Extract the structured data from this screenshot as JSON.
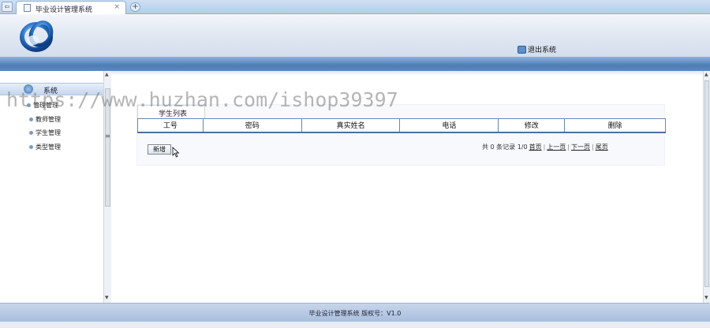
{
  "browser": {
    "tab_title": "毕业设计管理系统",
    "tab_close": "×",
    "new_tab": "+",
    "nav_glyph": "⇦"
  },
  "header": {
    "logout_label": "退出系统"
  },
  "sidebar": {
    "section_label": "系统",
    "items": [
      {
        "label": "管理管理"
      },
      {
        "label": "教师管理"
      },
      {
        "label": "学生管理"
      },
      {
        "label": "类型管理"
      }
    ],
    "grip": "≡"
  },
  "main": {
    "panel_title": "学生列表",
    "columns": [
      "工号",
      "密码",
      "真实姓名",
      "电话",
      "修改",
      "删除"
    ],
    "add_button": "新增",
    "pager": {
      "summary": "共 0 条记录 1/0",
      "first": "首页",
      "prev": "上一页",
      "next": "下一页",
      "last": "尾页",
      "sep": "|"
    }
  },
  "watermark": "https://www.huzhan.com/ishop39397",
  "footer": {
    "text": "毕业设计管理系统   版权号：V1.0"
  },
  "colors": {
    "band_blue": "#4e7cb8",
    "table_border": "#6b86b1"
  }
}
